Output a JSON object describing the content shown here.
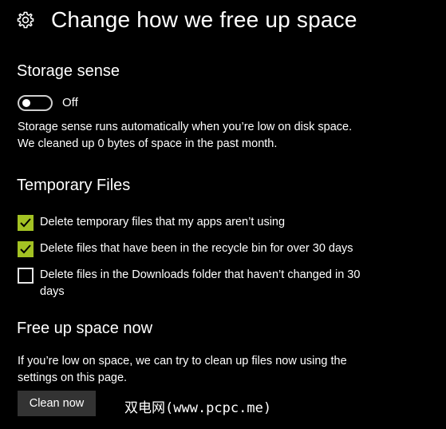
{
  "header": {
    "icon": "gear-icon",
    "title": "Change how we free up space"
  },
  "storage_sense": {
    "title": "Storage sense",
    "toggle_state": "Off",
    "description_line1": "Storage sense runs automatically when you’re low on disk space.",
    "description_line2": "We cleaned up 0 bytes of space in the past month."
  },
  "temporary_files": {
    "title": "Temporary Files",
    "options": [
      {
        "label": "Delete temporary files that my apps aren’t using",
        "checked": true
      },
      {
        "label": "Delete files that have been in the recycle bin for over 30 days",
        "checked": true
      },
      {
        "label": "Delete files in the Downloads folder that haven’t changed in 30 days",
        "checked": false
      }
    ]
  },
  "free_up": {
    "title": "Free up space now",
    "description_line1": "If you’re low on space, we can try to clean up files now using the",
    "description_line2": "settings on this page.",
    "button_label": "Clean now"
  },
  "watermark": "双电网(www.pcpc.me)",
  "colors": {
    "background": "#000000",
    "text": "#ffffff",
    "checkbox_accent": "#a3c223",
    "button_bg": "#333333"
  }
}
